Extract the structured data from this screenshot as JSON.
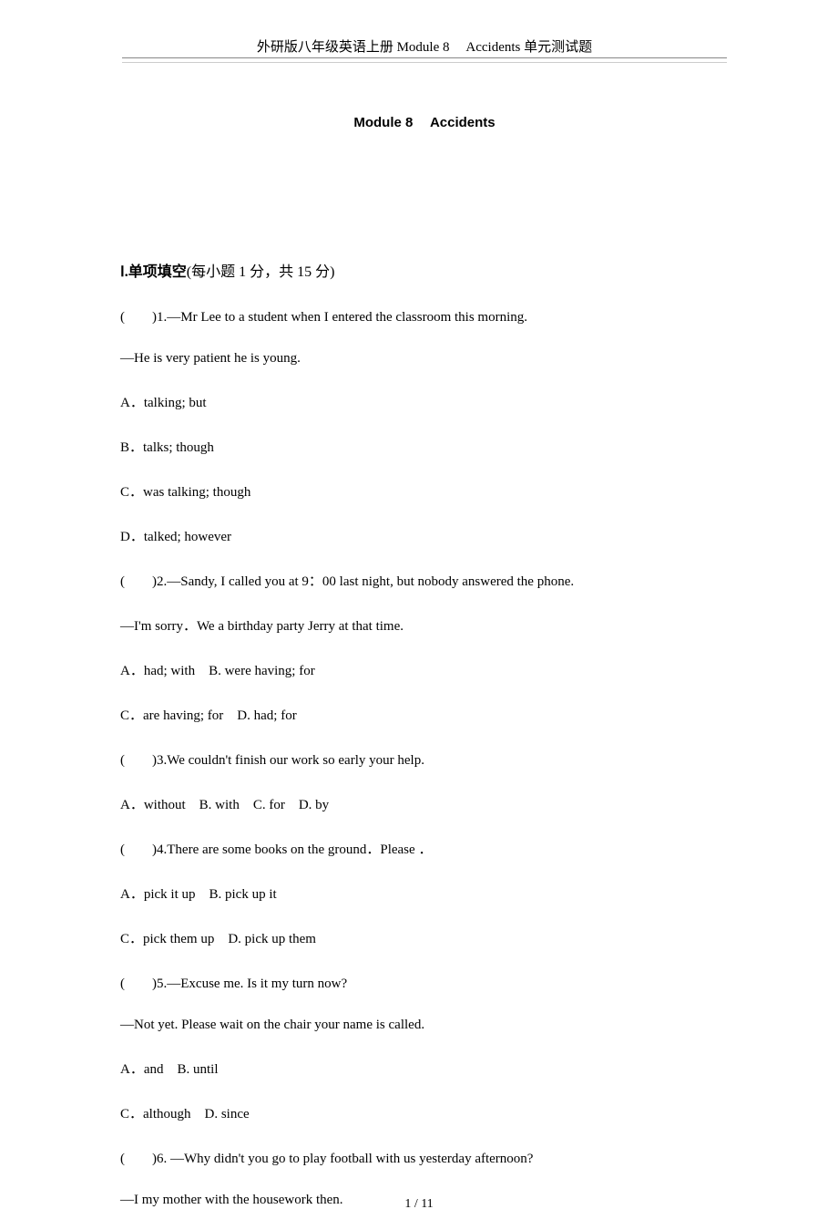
{
  "header": {
    "text": "外研版八年级英语上册 Module 8　 Accidents 单元测试题"
  },
  "title": {
    "text": "Module 8　 Accidents"
  },
  "section1": {
    "label": "Ⅰ.单项填空",
    "scoring": "(每小题 1 分，共 15 分)"
  },
  "questions": [
    {
      "num": "(　　)1.",
      "prompt_a": "—Mr Lee ",
      "prompt_b": "to a student when I entered the classroom this morning.",
      "line2_a": "—He is very patient ",
      "line2_b": " he is young.",
      "opts": [
        "A．talking; but",
        "B．talks; though",
        "C．was talking; though",
        "D．talked; however"
      ]
    },
    {
      "num": "(　　)2.",
      "prompt_a": "—Sandy, I called you at 9：00 last night, but nobody answered the phone.",
      "line2_a": "—I'm sorry．We ",
      "line2_b": " a birthday party ",
      "line2_c": " Jerry at that time.",
      "opts": [
        "A．had; with　B. were having; for",
        "C．are having; for　D. had; for"
      ]
    },
    {
      "num": "(　　)3.",
      "prompt_a": "We couldn't finish our work so early ",
      "prompt_b": " your help.",
      "opts": [
        "A．without　B. with　C. for　D. by"
      ]
    },
    {
      "num": "(　　)4.",
      "prompt_a": "There are some books on the ground．Please ",
      "prompt_b": "．",
      "opts": [
        "A．pick it up　B. pick up it",
        "C．pick them up　D. pick up them"
      ]
    },
    {
      "num": "(　　)5.",
      "prompt_a": "—Excuse me. Is it my turn now?",
      "line2_a": "—Not yet. Please wait on the chair ",
      "line2_b": " your name is called.",
      "opts": [
        "A．and　B. until",
        "C．although　D. since"
      ]
    },
    {
      "num": "(　　)6.",
      "prompt_a": " —Why didn't you go to play football with us yesterday afternoon?",
      "line2_a": "—I ",
      "line2_b": " my mother with the housework then."
    }
  ],
  "footer": {
    "text": "1 / 11"
  }
}
